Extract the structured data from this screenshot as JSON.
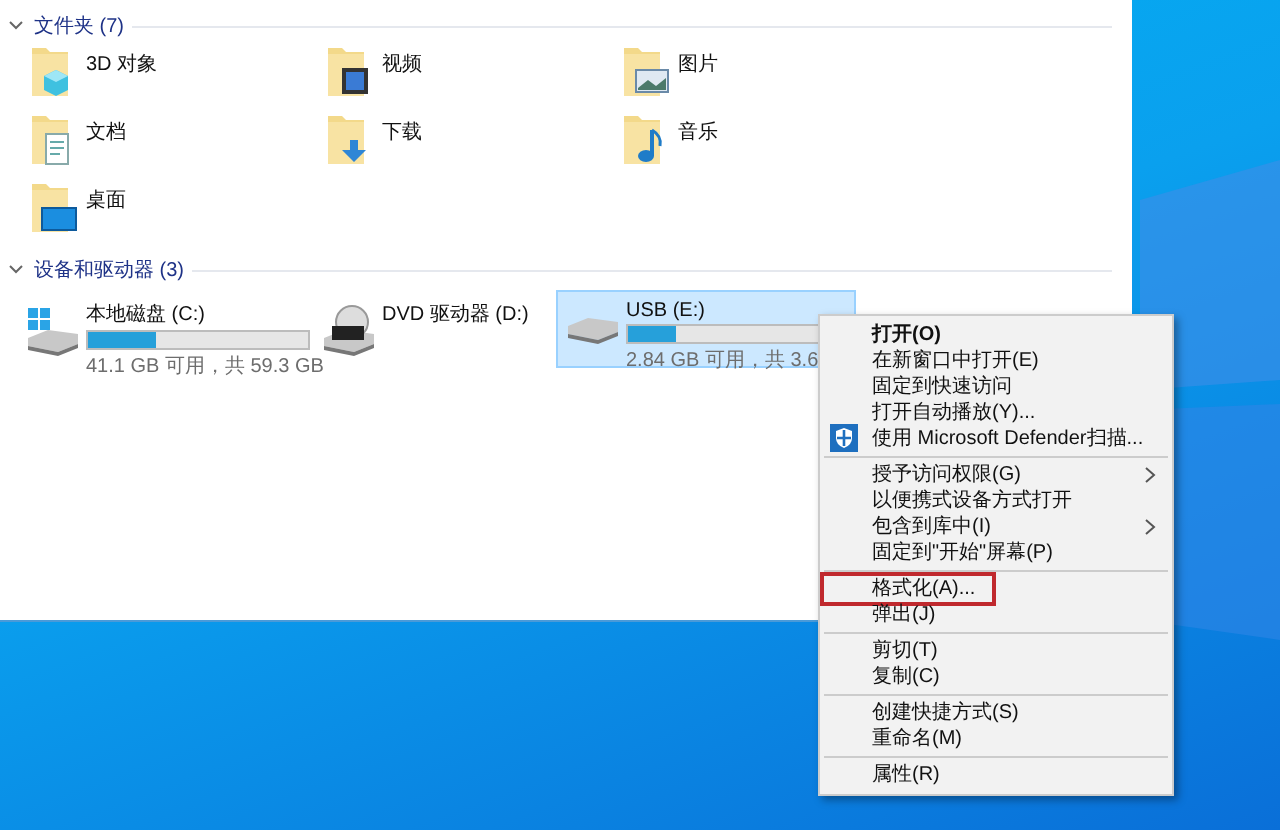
{
  "folders_section": {
    "title": "文件夹 (7)",
    "expanded": true,
    "items": [
      {
        "label": "3D 对象",
        "kind": "objects"
      },
      {
        "label": "视频",
        "kind": "video"
      },
      {
        "label": "图片",
        "kind": "pictures"
      },
      {
        "label": "文档",
        "kind": "documents"
      },
      {
        "label": "下载",
        "kind": "downloads"
      },
      {
        "label": "音乐",
        "kind": "music"
      },
      {
        "label": "桌面",
        "kind": "desktop"
      }
    ]
  },
  "drives_section": {
    "title": "设备和驱动器 (3)",
    "expanded": true,
    "items": [
      {
        "name": "本地磁盘 (C:)",
        "kind": "system",
        "level": 0.31,
        "space": "41.1 GB 可用，共 59.3 GB",
        "selected": false
      },
      {
        "name": "DVD 驱动器 (D:)",
        "kind": "dvd",
        "selected": false
      },
      {
        "name": "USB (E:)",
        "kind": "usb",
        "level": 0.22,
        "space": "2.84 GB 可用，共 3.6",
        "selected": true
      }
    ]
  },
  "context_menu": {
    "items": [
      {
        "kind": "command",
        "label": "打开(O)",
        "default": true
      },
      {
        "kind": "command",
        "label": "在新窗口中打开(E)"
      },
      {
        "kind": "command",
        "label": "固定到快速访问"
      },
      {
        "kind": "command",
        "label": "打开自动播放(Y)..."
      },
      {
        "kind": "shield-command",
        "label": "使用 Microsoft Defender扫描..."
      },
      {
        "kind": "separator"
      },
      {
        "kind": "command",
        "label": "授予访问权限(G)",
        "submenu": true
      },
      {
        "kind": "command",
        "label": "以便携式设备方式打开"
      },
      {
        "kind": "command",
        "label": "包含到库中(I)",
        "submenu": true
      },
      {
        "kind": "command",
        "label": "固定到\"开始\"屏幕(P)"
      },
      {
        "kind": "separator"
      },
      {
        "kind": "command",
        "label": "格式化(A)...",
        "marked": true
      },
      {
        "kind": "command",
        "label": "弹出(J)"
      },
      {
        "kind": "separator"
      },
      {
        "kind": "command",
        "label": "剪切(T)"
      },
      {
        "kind": "command",
        "label": "复制(C)"
      },
      {
        "kind": "separator"
      },
      {
        "kind": "command",
        "label": "创建快捷方式(S)"
      },
      {
        "kind": "command",
        "label": "重命名(M)"
      },
      {
        "kind": "separator"
      },
      {
        "kind": "command",
        "label": "属性(R)"
      }
    ]
  }
}
